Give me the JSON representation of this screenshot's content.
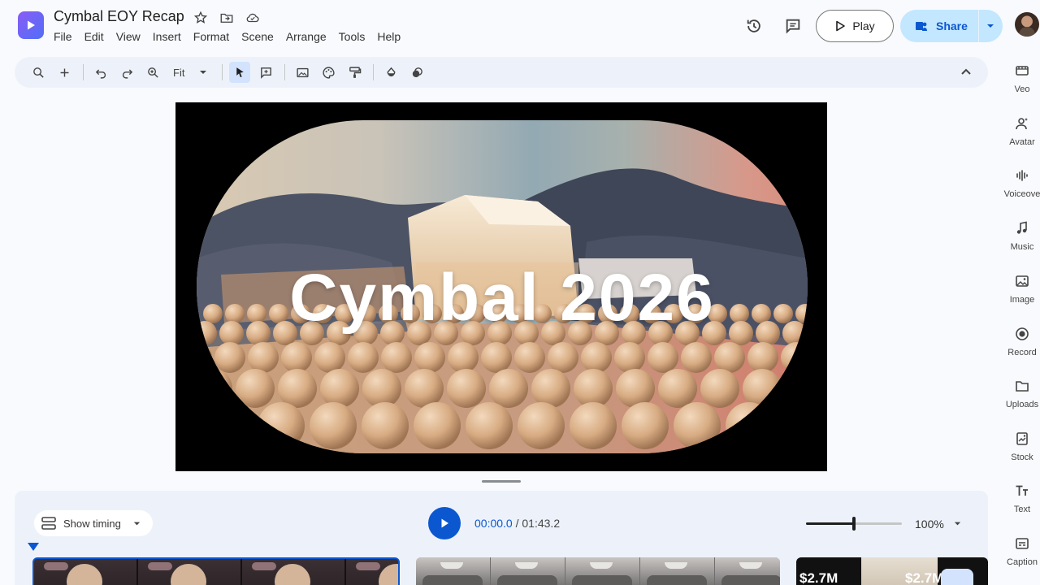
{
  "app": {
    "title": "Cymbal EOY Recap",
    "menu": [
      "File",
      "Edit",
      "View",
      "Insert",
      "Format",
      "Scene",
      "Arrange",
      "Tools",
      "Help"
    ]
  },
  "header": {
    "play_label": "Play",
    "share_label": "Share"
  },
  "toolbar": {
    "zoom_label": "Fit"
  },
  "canvas": {
    "title_text": "Cymbal 2026"
  },
  "timeline": {
    "show_timing_label": "Show timing",
    "current_time": "00:00.0",
    "separator": " / ",
    "total_time": "01:43.2",
    "zoom_level": 0.5,
    "zoom_pct": "100%",
    "clip3_label_a": "$2.7M",
    "clip3_label_b": "$2.7M"
  },
  "right_rail": {
    "items": [
      {
        "label": "Veo",
        "icon": "veo-icon"
      },
      {
        "label": "Avatar",
        "icon": "avatar-icon"
      },
      {
        "label": "Voiceove",
        "icon": "voiceover-icon"
      },
      {
        "label": "Music",
        "icon": "music-icon"
      },
      {
        "label": "Image",
        "icon": "image-icon"
      },
      {
        "label": "Record",
        "icon": "record-icon"
      },
      {
        "label": "Uploads",
        "icon": "folder-icon"
      },
      {
        "label": "Stock",
        "icon": "stock-icon"
      },
      {
        "label": "Text",
        "icon": "text-icon"
      },
      {
        "label": "Caption",
        "icon": "caption-icon"
      }
    ]
  },
  "colors": {
    "accent": "#0b57d0",
    "share_bg": "#c2e7ff",
    "toolbar_bg": "#edf2fa"
  }
}
